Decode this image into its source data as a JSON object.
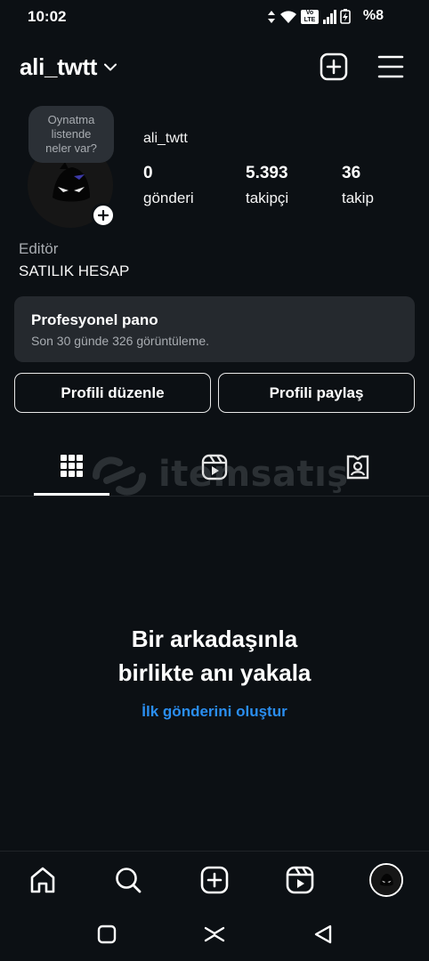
{
  "status": {
    "time": "10:02",
    "battery": "%8",
    "volte": "Vo LTE"
  },
  "header": {
    "username": "ali_twtt"
  },
  "note": {
    "lines": [
      "Oynatma",
      "listende",
      "neler var?"
    ]
  },
  "profile": {
    "name": "ali_twtt",
    "stats": [
      {
        "value": "0",
        "label": "gönderi"
      },
      {
        "value": "5.393",
        "label": "takipçi"
      },
      {
        "value": "36",
        "label": "takip"
      }
    ],
    "category": "Editör",
    "bio": "SATILIK HESAP"
  },
  "pro_panel": {
    "title": "Profesyonel pano",
    "subtitle": "Son 30 günde 326 görüntüleme."
  },
  "buttons": {
    "edit": "Profili düzenle",
    "share": "Profili paylaş"
  },
  "tabs": [
    "grid-icon",
    "reels-icon",
    "tagged-icon"
  ],
  "watermark": "itemsatış",
  "empty_state": {
    "line1": "Bir arkadaşınla",
    "line2": "birlikte anı yakala",
    "link": "İlk gönderini oluştur"
  },
  "colors": {
    "background": "#0c1014",
    "link": "#2a8ef0",
    "panel": "#25292e"
  }
}
